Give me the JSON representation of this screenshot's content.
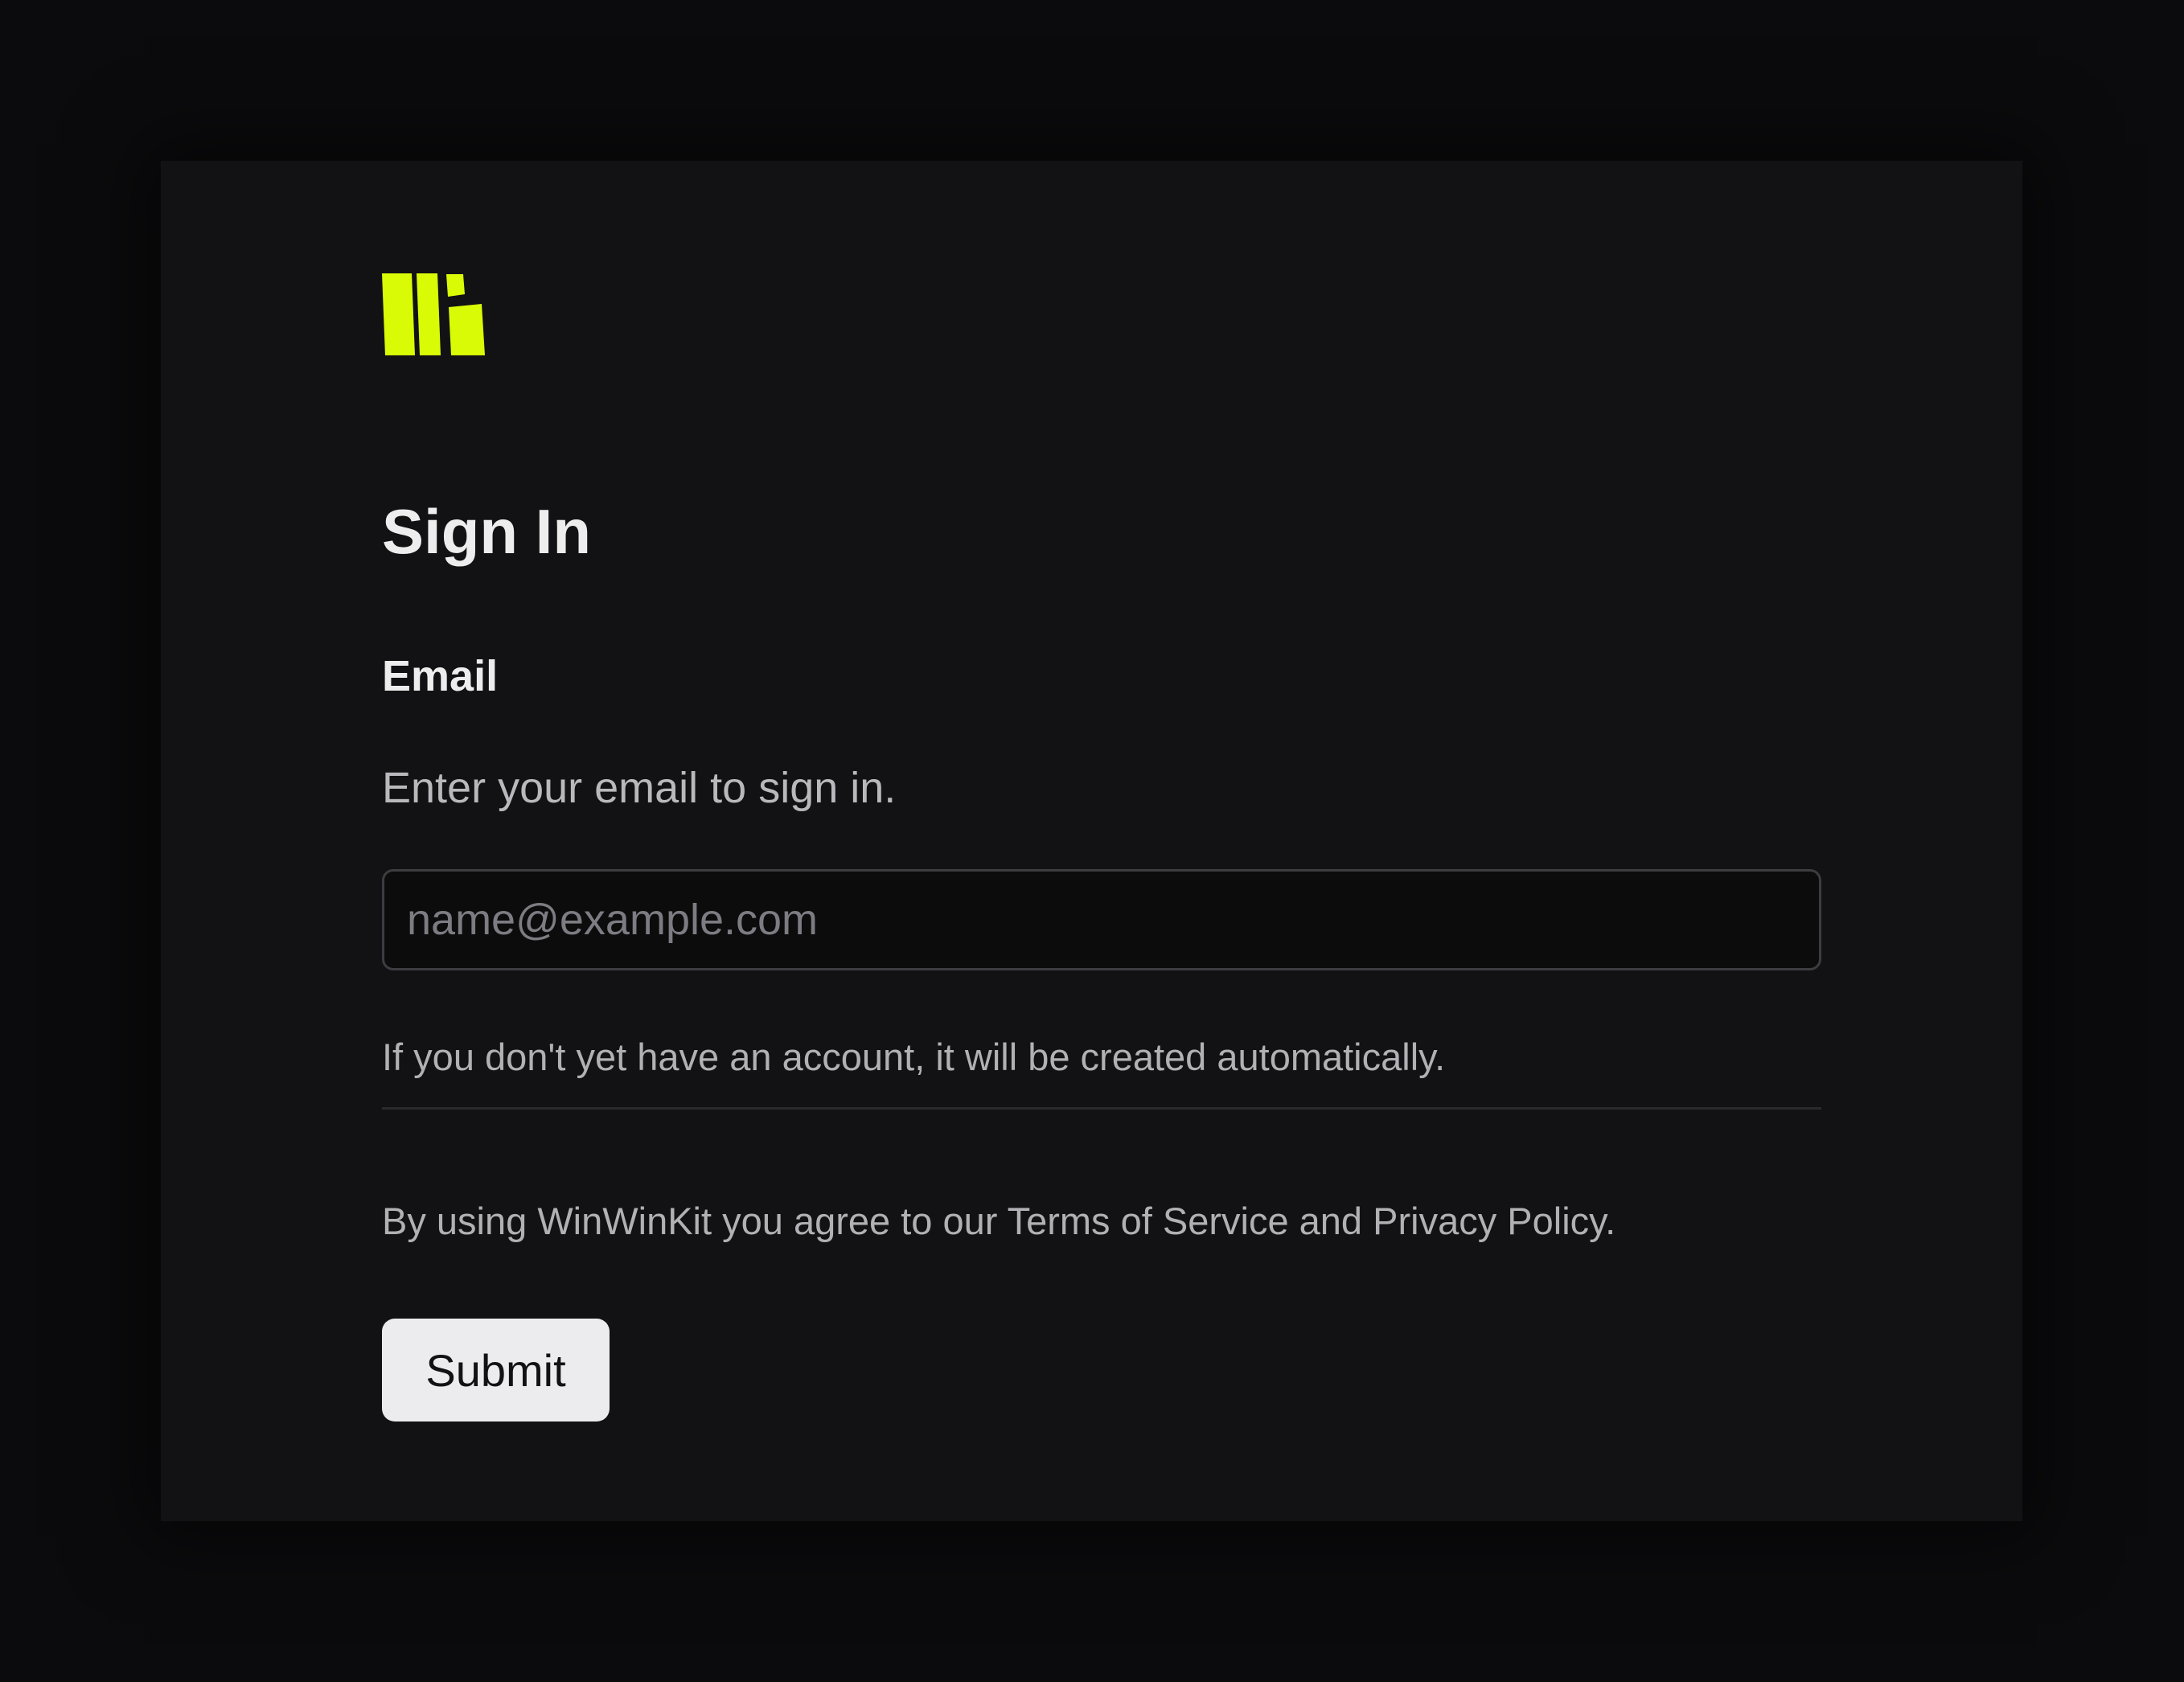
{
  "brand": {
    "name": "WinWinKit",
    "logo_icon": "winwinkit-logo-icon",
    "logo_color": "#d9fb06"
  },
  "page": {
    "title": "Sign In"
  },
  "form": {
    "email_label": "Email",
    "email_description": "Enter your email to sign in.",
    "email_placeholder": "name@example.com",
    "email_value": "",
    "hint": "If you don't yet have an account, it will be created automatically.",
    "terms": "By using WinWinKit you agree to our Terms of Service and Privacy Policy.",
    "submit_label": "Submit"
  },
  "colors": {
    "background": "#0b0b0d",
    "card": "#121214",
    "button": "#ececee",
    "text_primary": "#ededee",
    "text_secondary": "#b1b1b5"
  }
}
